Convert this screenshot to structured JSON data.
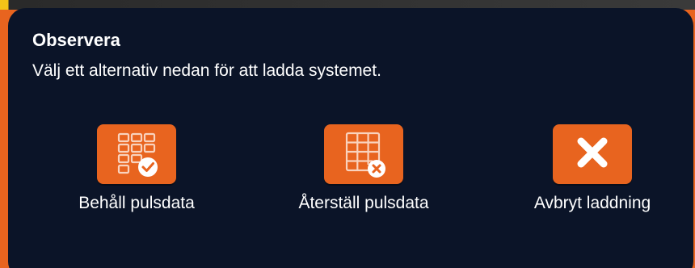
{
  "dialog": {
    "title": "Observera",
    "message": "Välj ett alternativ nedan för att ladda systemet."
  },
  "options": [
    {
      "label": "Behåll pulsdata",
      "icon": "grid-check-icon"
    },
    {
      "label": "Återställ pulsdata",
      "icon": "grid-x-icon"
    },
    {
      "label": "Avbryt laddning",
      "icon": "close-icon"
    }
  ],
  "colors": {
    "accent": "#e8641f",
    "background": "#0b1428",
    "text": "#ffffff"
  }
}
